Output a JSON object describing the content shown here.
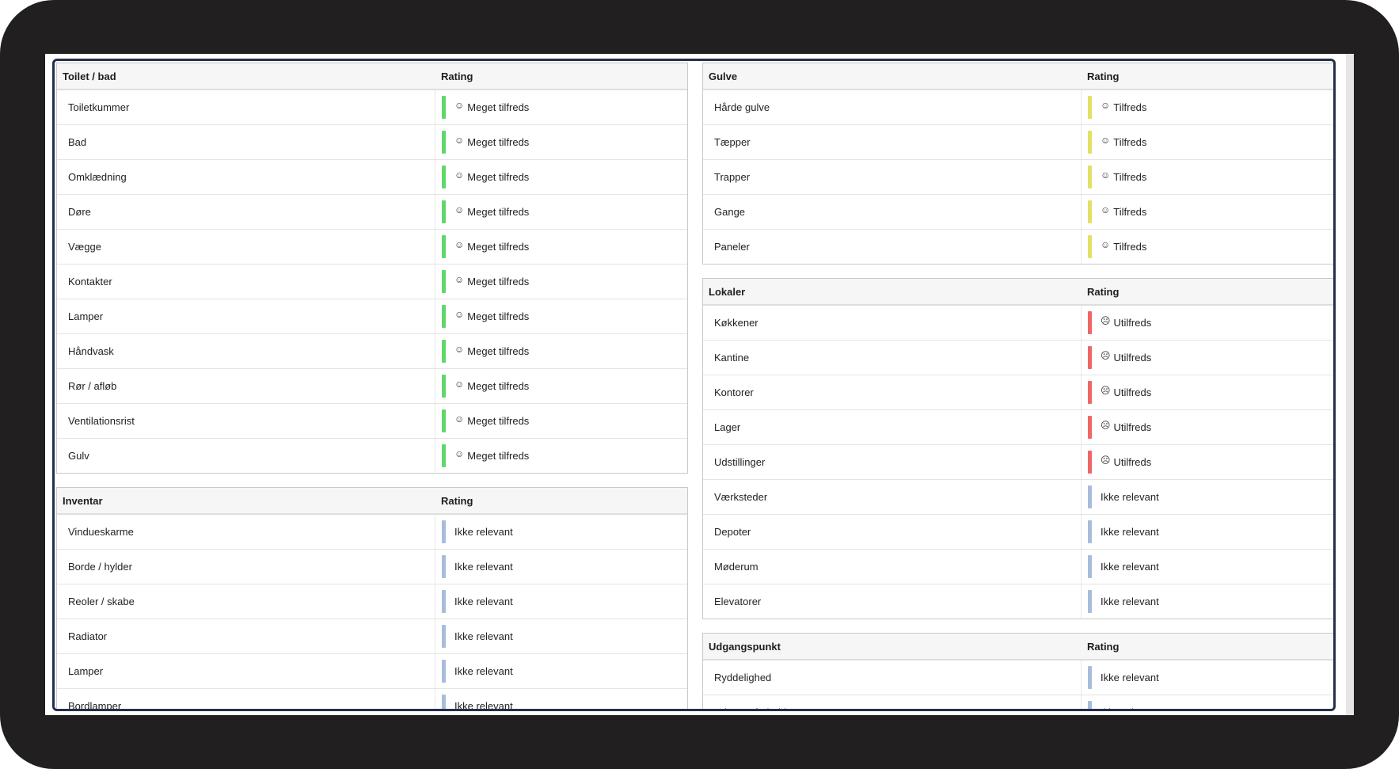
{
  "rating_header": "Rating",
  "face_glyphs": {
    "happy": "☺",
    "sad": "☹"
  },
  "colors": {
    "green": "#5fd86b",
    "yellow": "#e2e066",
    "red": "#ef6666",
    "blue": "#a8bcdb",
    "frame": "#24304b"
  },
  "left_tables": [
    {
      "title": "Toilet / bad",
      "rows": [
        {
          "item": "Toiletkummer",
          "rating": "Meget tilfreds",
          "level": "green",
          "face": "happy"
        },
        {
          "item": "Bad",
          "rating": "Meget tilfreds",
          "level": "green",
          "face": "happy"
        },
        {
          "item": "Omklædning",
          "rating": "Meget tilfreds",
          "level": "green",
          "face": "happy"
        },
        {
          "item": "Døre",
          "rating": "Meget tilfreds",
          "level": "green",
          "face": "happy"
        },
        {
          "item": "Vægge",
          "rating": "Meget tilfreds",
          "level": "green",
          "face": "happy"
        },
        {
          "item": "Kontakter",
          "rating": "Meget tilfreds",
          "level": "green",
          "face": "happy"
        },
        {
          "item": "Lamper",
          "rating": "Meget tilfreds",
          "level": "green",
          "face": "happy"
        },
        {
          "item": "Håndvask",
          "rating": "Meget tilfreds",
          "level": "green",
          "face": "happy"
        },
        {
          "item": "Rør / afløb",
          "rating": "Meget tilfreds",
          "level": "green",
          "face": "happy"
        },
        {
          "item": "Ventilationsrist",
          "rating": "Meget tilfreds",
          "level": "green",
          "face": "happy"
        },
        {
          "item": "Gulv",
          "rating": "Meget tilfreds",
          "level": "green",
          "face": "happy"
        }
      ]
    },
    {
      "title": "Inventar",
      "open": true,
      "rows": [
        {
          "item": "Vindueskarme",
          "rating": "Ikke relevant",
          "level": "blue",
          "face": ""
        },
        {
          "item": "Borde / hylder",
          "rating": "Ikke relevant",
          "level": "blue",
          "face": ""
        },
        {
          "item": "Reoler / skabe",
          "rating": "Ikke relevant",
          "level": "blue",
          "face": ""
        },
        {
          "item": "Radiator",
          "rating": "Ikke relevant",
          "level": "blue",
          "face": ""
        },
        {
          "item": "Lamper",
          "rating": "Ikke relevant",
          "level": "blue",
          "face": ""
        },
        {
          "item": "Bordlamper",
          "rating": "Ikke relevant",
          "level": "blue",
          "face": ""
        }
      ]
    }
  ],
  "right_tables": [
    {
      "title": "Gulve",
      "rows": [
        {
          "item": "Hårde gulve",
          "rating": "Tilfreds",
          "level": "yellow",
          "face": "happy"
        },
        {
          "item": "Tæpper",
          "rating": "Tilfreds",
          "level": "yellow",
          "face": "happy"
        },
        {
          "item": "Trapper",
          "rating": "Tilfreds",
          "level": "yellow",
          "face": "happy"
        },
        {
          "item": "Gange",
          "rating": "Tilfreds",
          "level": "yellow",
          "face": "happy"
        },
        {
          "item": "Paneler",
          "rating": "Tilfreds",
          "level": "yellow",
          "face": "happy"
        }
      ]
    },
    {
      "title": "Lokaler",
      "rows": [
        {
          "item": "Køkkener",
          "rating": "Utilfreds",
          "level": "red",
          "face": "sad"
        },
        {
          "item": "Kantine",
          "rating": "Utilfreds",
          "level": "red",
          "face": "sad"
        },
        {
          "item": "Kontorer",
          "rating": "Utilfreds",
          "level": "red",
          "face": "sad"
        },
        {
          "item": "Lager",
          "rating": "Utilfreds",
          "level": "red",
          "face": "sad"
        },
        {
          "item": "Udstillinger",
          "rating": "Utilfreds",
          "level": "red",
          "face": "sad"
        },
        {
          "item": "Værksteder",
          "rating": "Ikke relevant",
          "level": "blue",
          "face": ""
        },
        {
          "item": "Depoter",
          "rating": "Ikke relevant",
          "level": "blue",
          "face": ""
        },
        {
          "item": "Møderum",
          "rating": "Ikke relevant",
          "level": "blue",
          "face": ""
        },
        {
          "item": "Elevatorer",
          "rating": "Ikke relevant",
          "level": "blue",
          "face": ""
        }
      ]
    },
    {
      "title": "Udgangspunkt",
      "open": true,
      "rows": [
        {
          "item": "Ryddelighed",
          "rating": "Ikke relevant",
          "level": "blue",
          "face": ""
        },
        {
          "item": "Adgangsforhold",
          "rating": "Ikke relevant",
          "level": "blue",
          "face": ""
        }
      ]
    }
  ]
}
